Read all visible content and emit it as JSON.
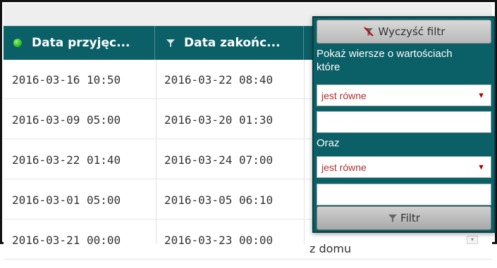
{
  "table": {
    "columns": [
      {
        "label": "Data przyjęc..."
      },
      {
        "label": "Data zakońc..."
      }
    ],
    "rows": [
      {
        "start": "2016-03-16 10:50",
        "end": "2016-03-22 08:40",
        "extra": ""
      },
      {
        "start": "2016-03-09 05:00",
        "end": "2016-03-20 01:30",
        "extra": ""
      },
      {
        "start": "2016-03-22 01:40",
        "end": "2016-03-24 07:00",
        "extra": ""
      },
      {
        "start": "2016-03-01 05:00",
        "end": "2016-03-05 06:10",
        "extra": ""
      },
      {
        "start": "2016-03-21 00:00",
        "end": "2016-03-23 00:00",
        "extra": "z domu"
      }
    ]
  },
  "filter_popup": {
    "clear_label": "Wyczyść filtr",
    "show_rows_label": "Pokaż wiersze o wartościach które",
    "condition1": "jest równe",
    "value1": "",
    "and_label": "Oraz",
    "condition2": "jest równe",
    "value2": "",
    "apply_label": "Filtr"
  },
  "colors": {
    "header_bg": "#0b5f66",
    "popup_bg": "#0b5f66",
    "status_green": "#2bbf1e"
  }
}
